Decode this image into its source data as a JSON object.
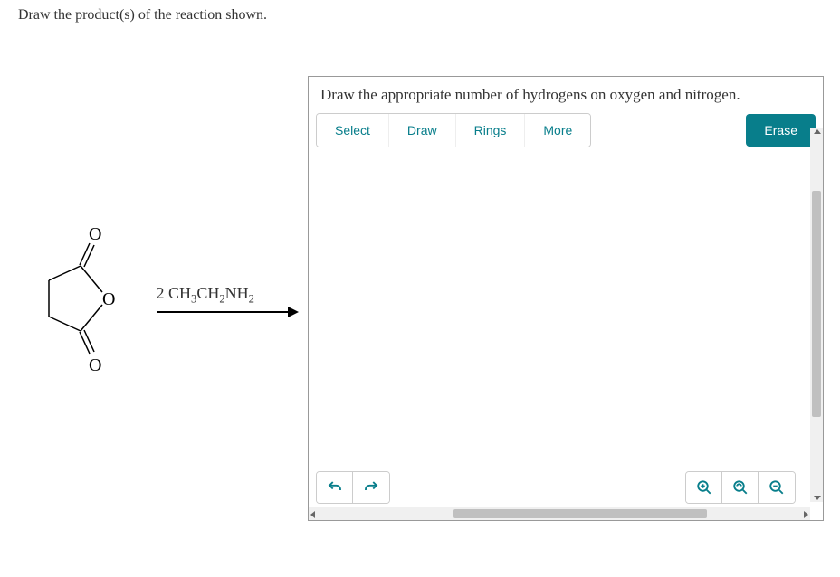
{
  "prompt": "Draw the product(s) of the reaction shown.",
  "reaction": {
    "reagent_prefix": "2  ",
    "reagent_formula_parts": [
      "CH",
      "3",
      "CH",
      "2",
      "NH",
      "2"
    ]
  },
  "editor": {
    "instruction": "Draw the appropriate number of hydrogens on oxygen and nitrogen.",
    "toolbar": {
      "select": "Select",
      "draw": "Draw",
      "rings": "Rings",
      "more": "More",
      "erase": "Erase"
    },
    "icons": {
      "undo": "↶",
      "redo": "↷",
      "zoom_in": "⊕",
      "zoom_reset": "⟲",
      "zoom_out": "⊖"
    }
  }
}
